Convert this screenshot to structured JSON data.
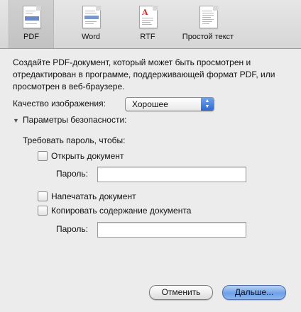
{
  "toolbar": {
    "items": [
      {
        "label": "PDF",
        "icon": "pdf-document-icon",
        "selected": true
      },
      {
        "label": "Word",
        "icon": "word-document-icon",
        "selected": false
      },
      {
        "label": "RTF",
        "icon": "rtf-document-icon",
        "selected": false
      },
      {
        "label": "Простой текст",
        "icon": "plain-text-document-icon",
        "selected": false
      }
    ]
  },
  "description": "Создайте PDF-документ, который может быть просмотрен и отредактирован в программе, поддерживающей формат PDF, или просмотрен в веб-браузере.",
  "quality": {
    "label": "Качество изображения:",
    "value": "Хорошее"
  },
  "security": {
    "disclosure_label": "Параметры безопасности:",
    "require_label": "Требовать пароль, чтобы:",
    "open_document": {
      "label": "Открыть документ",
      "checked": false
    },
    "password_label_1": "Пароль:",
    "password_value_1": "",
    "print_document": {
      "label": "Напечатать документ",
      "checked": false
    },
    "copy_content": {
      "label": "Копировать содержание документа",
      "checked": false
    },
    "password_label_2": "Пароль:",
    "password_value_2": ""
  },
  "buttons": {
    "cancel": "Отменить",
    "next": "Дальше..."
  },
  "colors": {
    "accent": "#4a86e8",
    "window_bg": "#ececec"
  }
}
